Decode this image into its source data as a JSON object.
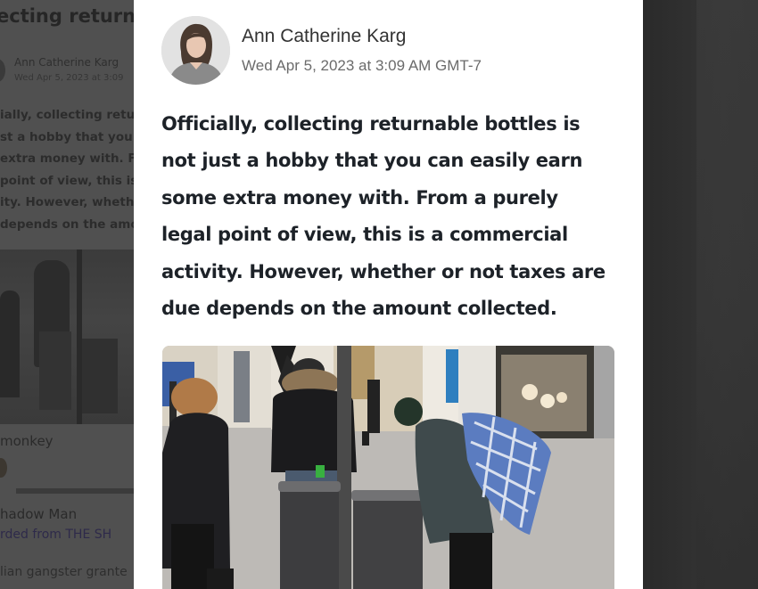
{
  "background": {
    "title_fragment": "ecting returnab",
    "author": "Ann Catherine Karg",
    "date": "Wed Apr 5, 2023 at 3:09",
    "text_lines": [
      "ially, collecting return",
      "st a hobby that you c",
      "extra money with. Fr",
      "point of view, this is a",
      "ity. However, whether",
      "depends on the amoun"
    ],
    "comment_user": "monkey",
    "second_user": "hadow Man",
    "link_text": "rded from THE SH",
    "teaser": "lian gangster grante"
  },
  "post": {
    "author_name": "Ann Catherine Karg",
    "date": "Wed Apr 5, 2023 at 3:09 AM GMT-7",
    "body_lines": [
      "Officially, collecting returnable bottles is",
      "not just a hobby that you can easily earn",
      "some extra money with. From a purely",
      "legal point of view, this is a commercial",
      "activity. However, whether or not taxes are",
      "due depends on the amount collected."
    ],
    "avatar_icon": "author-avatar",
    "photo_icon": "bottle-collectors-photo"
  }
}
